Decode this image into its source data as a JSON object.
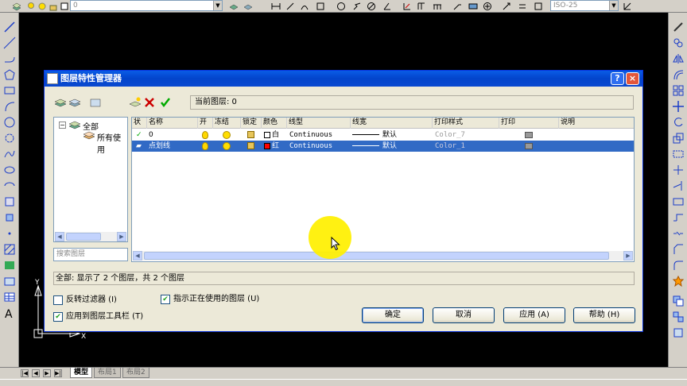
{
  "toolbar": {
    "layer_combo_value": "0",
    "dimstyle_combo_value": "ISO-25"
  },
  "layout_tabs": [
    "模型",
    "布局1",
    "布局2"
  ],
  "dialog": {
    "title": "图层特性管理器",
    "help_glyph": "?",
    "close_glyph": "×",
    "current_layer_label": "当前图层: 0",
    "tree": {
      "root_label": "全部",
      "child_label": "所有使用",
      "search_placeholder": "搜索图层"
    },
    "columns": [
      "状",
      "名称",
      "开",
      "冻结",
      "锁定",
      "颜色",
      "线型",
      "线宽",
      "打印样式",
      "打印",
      "说明"
    ],
    "rows": [
      {
        "status": "✓",
        "name": "0",
        "color": "白",
        "color_hex": "#ffffff",
        "linetype": "Continuous",
        "lineweight": "默认",
        "plot_style": "Color_7",
        "selected": false
      },
      {
        "status": "▰",
        "name": "点划线",
        "color": "红",
        "color_hex": "#ff0000",
        "linetype": "Continuous",
        "lineweight": "默认",
        "plot_style": "Color_1",
        "selected": true
      }
    ],
    "summary": "全部: 显示了 2 个图层，共 2 个图层",
    "options": {
      "invert_filter": {
        "label": "反转过滤器 (I)",
        "checked": false
      },
      "indicate_in_use": {
        "label": "指示正在使用的图层 (U)",
        "checked": true
      },
      "apply_to_toolbar": {
        "label": "应用到图层工具栏 (T)",
        "checked": true
      }
    },
    "buttons": {
      "ok": "确定",
      "cancel": "取消",
      "apply": "应用 (A)",
      "help": "帮助 (H)"
    }
  },
  "colors": {
    "titlebar": "#0a5ce6",
    "selection": "#316ac5",
    "canvas": "#000000",
    "highlight": "#fff000"
  }
}
